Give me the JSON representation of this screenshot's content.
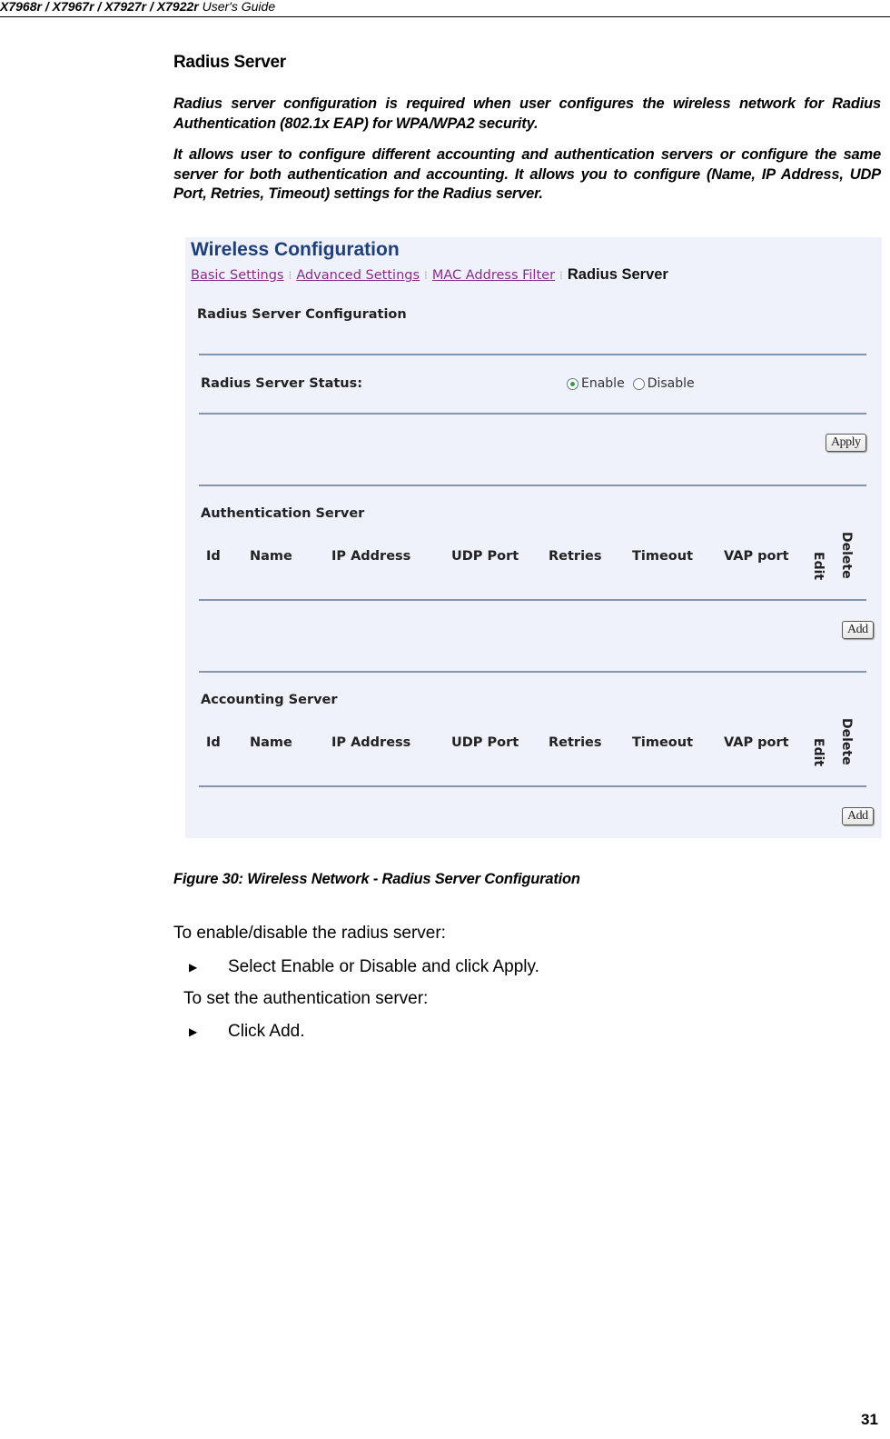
{
  "header": {
    "models": "X7968r / X7967r / X7927r / X7922r",
    "guide": "User's Guide"
  },
  "section_title": "Radius Server",
  "paragraphs": [
    "Radius server configuration is required when user configures the wireless network for Radius Authentication (802.1x EAP) for WPA/WPA2 security.",
    "It allows user to configure different accounting and authentication servers or configure the same server for both authentication and accounting. It allows you to configure (Name, IP Address, UDP Port, Retries, Timeout) settings for the Radius server."
  ],
  "screenshot": {
    "title": "Wireless Configuration",
    "tabs": [
      {
        "label": "Basic Settings",
        "active": false
      },
      {
        "label": "Advanced Settings",
        "active": false
      },
      {
        "label": "MAC Address Filter",
        "active": false
      },
      {
        "label": "Radius Server",
        "active": true
      }
    ],
    "tab_separator": "⁞",
    "subtitle": "Radius Server Configuration",
    "status": {
      "label": "Radius Server Status:",
      "options": [
        {
          "label": "Enable",
          "checked": true
        },
        {
          "label": "Disable",
          "checked": false
        }
      ]
    },
    "apply_label": "Apply",
    "auth_server": {
      "title": "Authentication Server",
      "columns": [
        "Id",
        "Name",
        "IP Address",
        "UDP Port",
        "Retries",
        "Timeout",
        "VAP port",
        "Edit",
        "Delete"
      ],
      "add_label": "Add"
    },
    "acct_server": {
      "title": "Accounting Server",
      "columns": [
        "Id",
        "Name",
        "IP Address",
        "UDP Port",
        "Retries",
        "Timeout",
        "VAP port",
        "Edit",
        "Delete"
      ],
      "add_label": "Add"
    },
    "colors": {
      "panel_bg": "#eff2fa",
      "title": "#1f3f7a",
      "link": "#8a2c8c",
      "divider": "#8495ad",
      "radio_dot": "#3a9a4a"
    }
  },
  "caption": "Figure 30: Wireless Network - Radius Server Configuration",
  "instructions": {
    "intro1": "To enable/disable the radius server:",
    "step1": "Select Enable or Disable and click Apply.",
    "intro2": "To set the authentication server:",
    "step2": "Click Add.",
    "bullet_icon": "▶"
  },
  "page_number": "31"
}
